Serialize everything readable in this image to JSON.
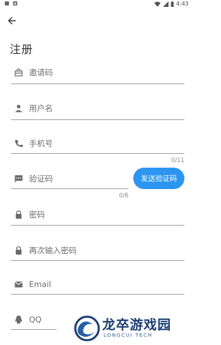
{
  "status_bar": {
    "time": "4:43",
    "icons": [
      "notification-square-icon",
      "download-icon",
      "wifi-icon",
      "signal-icon",
      "battery-icon"
    ]
  },
  "header": {
    "back_icon": "arrow-left-icon"
  },
  "page": {
    "title": "注册"
  },
  "form": {
    "invite_code": {
      "placeholder": "邀请码",
      "value": "",
      "icon": "gift-icon"
    },
    "username": {
      "placeholder": "用户名",
      "value": "",
      "icon": "person-icon"
    },
    "phone": {
      "placeholder": "手机号",
      "value": "",
      "icon": "phone-icon",
      "counter": "0/11"
    },
    "verify_code": {
      "placeholder": "验证码",
      "value": "",
      "icon": "message-icon",
      "counter": "0/6"
    },
    "send_code_button": "发送验证码",
    "password": {
      "placeholder": "密码",
      "value": "",
      "icon": "lock-icon"
    },
    "confirm_password": {
      "placeholder": "再次输入密码",
      "value": "",
      "icon": "lock-icon"
    },
    "email": {
      "placeholder": "Email",
      "value": "",
      "icon": "mail-icon"
    },
    "qq": {
      "placeholder": "QQ",
      "value": "",
      "icon": "qq-icon"
    }
  },
  "watermark": {
    "main": "龙卒游戏园",
    "sub": "LONGCUI TECH"
  },
  "colors": {
    "accent": "#2b95ef",
    "underline": "#9e9e9e",
    "icon": "#6b6b6b",
    "watermark": "#1b3d73"
  }
}
